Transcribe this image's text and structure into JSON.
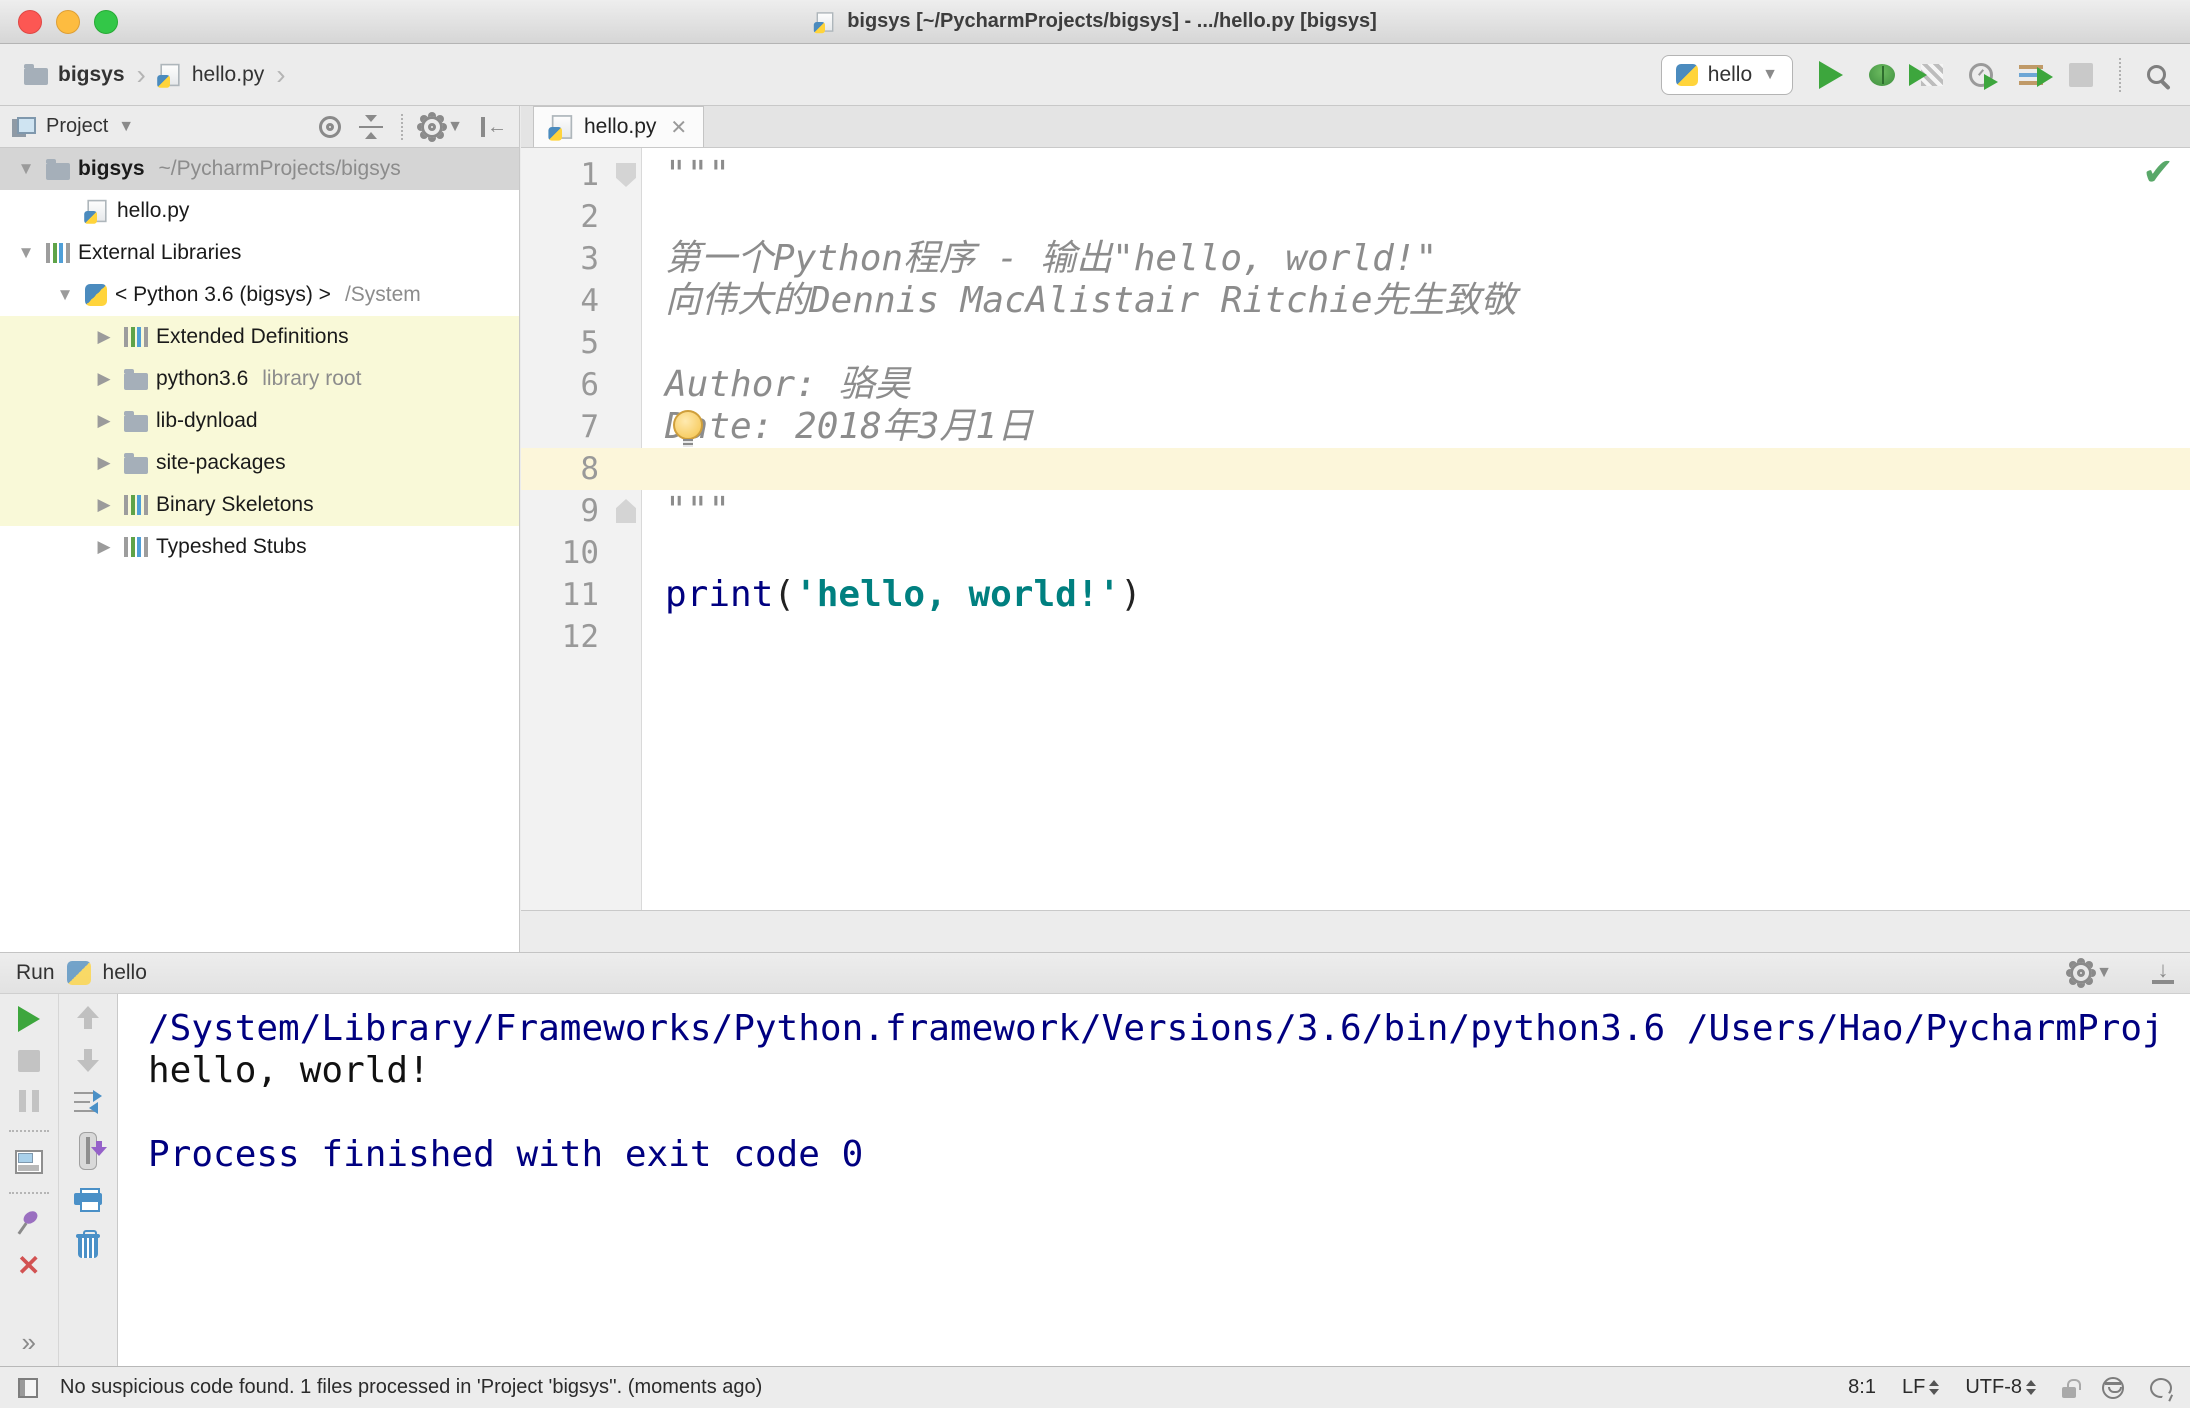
{
  "window": {
    "title": "bigsys [~/PycharmProjects/bigsys] - .../hello.py [bigsys]"
  },
  "navbar": {
    "breadcrumbs": [
      {
        "label": "bigsys",
        "icon": "folder-icon"
      },
      {
        "label": "hello.py",
        "icon": "python-file-icon"
      }
    ],
    "run_config": {
      "label": "hello",
      "icon": "python-icon"
    },
    "action_icons": [
      "run-icon",
      "debug-icon",
      "run-with-coverage-icon",
      "profiler-icon",
      "concurrency-diagram-icon",
      "stop-icon",
      "search-everywhere-icon"
    ]
  },
  "project_panel": {
    "title": "Project",
    "header_icons": [
      "locate-icon",
      "collapse-all-icon",
      "settings-gear-icon",
      "hide-panel-icon"
    ],
    "tree": [
      {
        "label": "bigsys",
        "hint": "~/PycharmProjects/bigsys",
        "icon": "folder",
        "arrow": "down",
        "indent": 0,
        "selected": true,
        "bold": true
      },
      {
        "label": "hello.py",
        "icon": "python-file",
        "arrow": "",
        "indent": 1
      },
      {
        "label": "External Libraries",
        "icon": "library",
        "arrow": "down",
        "indent": 0
      },
      {
        "label": "< Python 3.6 (bigsys) >",
        "hint": "/System",
        "icon": "python",
        "arrow": "down",
        "indent": 1
      },
      {
        "label": "Extended Definitions",
        "icon": "library",
        "arrow": "right",
        "indent": 2,
        "highlight": true
      },
      {
        "label": "python3.6",
        "hint": "library root",
        "icon": "folder",
        "arrow": "right",
        "indent": 2,
        "highlight": true
      },
      {
        "label": "lib-dynload",
        "icon": "folder",
        "arrow": "right",
        "indent": 2,
        "highlight": true
      },
      {
        "label": "site-packages",
        "icon": "folder",
        "arrow": "right",
        "indent": 2,
        "highlight": true
      },
      {
        "label": "Binary Skeletons",
        "icon": "library",
        "arrow": "right",
        "indent": 2,
        "highlight": true
      },
      {
        "label": "Typeshed Stubs",
        "icon": "library",
        "arrow": "right",
        "indent": 2,
        "highlight": false
      }
    ]
  },
  "editor": {
    "tab": {
      "label": "hello.py"
    },
    "inspection_status": "ok",
    "lines": [
      {
        "num": 1,
        "fold": "start",
        "tokens": [
          {
            "text": "\"\"\"",
            "style": "doc"
          }
        ]
      },
      {
        "num": 2,
        "tokens": []
      },
      {
        "num": 3,
        "tokens": [
          {
            "text": "第一个Python程序 - 输出\"hello, world!\"",
            "style": "doc"
          }
        ]
      },
      {
        "num": 4,
        "tokens": [
          {
            "text": "向伟大的Dennis MacAlistair Ritchie先生致敬",
            "style": "doc"
          }
        ]
      },
      {
        "num": 5,
        "tokens": []
      },
      {
        "num": 6,
        "tokens": [
          {
            "text": "Author: 骆昊",
            "style": "doc"
          }
        ]
      },
      {
        "num": 7,
        "bulb": true,
        "tokens": [
          {
            "text": "Date: 2018年3月1日",
            "style": "doc"
          }
        ]
      },
      {
        "num": 8,
        "current": true,
        "tokens": []
      },
      {
        "num": 9,
        "fold": "end",
        "tokens": [
          {
            "text": "\"\"\"",
            "style": "doc"
          }
        ]
      },
      {
        "num": 10,
        "tokens": []
      },
      {
        "num": 11,
        "tokens": [
          {
            "text": "print",
            "style": "keyword"
          },
          {
            "text": "(",
            "style": "plain"
          },
          {
            "text": "'hello, world!'",
            "style": "string"
          },
          {
            "text": ")",
            "style": "plain"
          }
        ]
      },
      {
        "num": 12,
        "tokens": []
      }
    ]
  },
  "run_panel": {
    "label": "Run",
    "config": "hello",
    "header_icons": [
      "settings-gear-icon",
      "hide-panel-down-icon"
    ],
    "toolbar_icons_col1": [
      "rerun-icon",
      "stop-icon",
      "pause-output-icon",
      "restore-layout-icon",
      "pin-tab-icon",
      "close-icon",
      "more-icon"
    ],
    "toolbar_icons_col2": [
      "up-stacktrace-icon",
      "down-stacktrace-icon",
      "soft-wrap-icon",
      "scroll-to-end-icon",
      "print-icon",
      "clear-all-icon"
    ],
    "console": [
      {
        "text": "/System/Library/Frameworks/Python.framework/Versions/3.6/bin/python3.6 /Users/Hao/PycharmProj",
        "style": "info"
      },
      {
        "text": "hello, world!",
        "style": "stdout"
      },
      {
        "text": "",
        "style": "stdout"
      },
      {
        "text": "Process finished with exit code 0",
        "style": "info"
      }
    ]
  },
  "status_bar": {
    "message": "No suspicious code found. 1 files processed in 'Project 'bigsys''. (moments ago)",
    "caret_position": "8:1",
    "line_separator": "LF",
    "encoding": "UTF-8",
    "right_icons": [
      "lock-unlocked-icon",
      "hector-inspector-icon",
      "event-balloon-icon"
    ]
  },
  "colors": {
    "accent_green": "#59a869",
    "keyword": "#000080",
    "string": "#008080",
    "docstring": "#8c8c8c",
    "console_info": "#000080",
    "library_highlight": "#f9f9d8",
    "current_line": "#fcf6da",
    "selection_gray": "#d5d5d5"
  }
}
